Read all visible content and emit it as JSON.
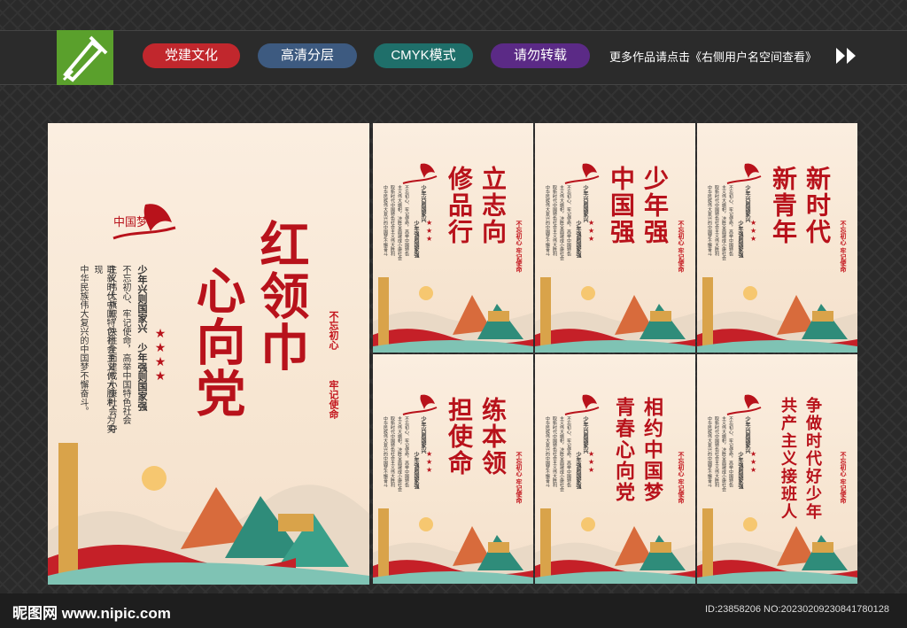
{
  "topbar": {
    "tags": [
      {
        "label": "党建文化",
        "color": "#c1272d"
      },
      {
        "label": "高清分层",
        "color": "#3d5a80"
      },
      {
        "label": "CMYK模式",
        "color": "#1f6f6a"
      },
      {
        "label": "请勿转载",
        "color": "#5b2a86"
      }
    ],
    "notice": "更多作品请点击《右侧用户名空间查看》"
  },
  "main_panel": {
    "title_line1": "红领巾",
    "title_line2": "心向党",
    "slogan_a": "不忘初心",
    "slogan_b": "牢记使命",
    "subtitle_a": "少年兴则国家兴",
    "subtitle_b": "少年强则国家强",
    "paragraph": [
      "不忘初心、牢记使命，高举中国特色社会",
      "主义伟大旗帜，决胜全面建成小康社会，夺",
      "取新时代中国特色社会主义伟大胜利，为实现",
      "中华民族伟大复兴的中国梦不懈奋斗。"
    ],
    "emblem_text": "中国梦"
  },
  "panels": [
    {
      "title": [
        "立志向",
        "修品行"
      ],
      "slogan": "不忘初心 牢记使命"
    },
    {
      "title": [
        "少年强",
        "中国强"
      ],
      "slogan": "不忘初心 牢记使命"
    },
    {
      "title": [
        "新时代",
        "新青年"
      ],
      "slogan": "不忘初心 牢记使命"
    },
    {
      "title": [
        "练本领",
        "担使命"
      ],
      "slogan": "不忘初心 牢记使命"
    },
    {
      "title": [
        "相约中国梦",
        "青春心向党"
      ],
      "slogan": "不忘初心 牢记使命"
    },
    {
      "title": [
        "争做时代好少年",
        "共产主义接班人"
      ],
      "slogan": "不忘初心 牢记使命"
    }
  ],
  "small_text": [
    "少年兴则国家兴",
    "少年强则国家强"
  ],
  "small_paragraph": [
    "不忘初心、牢记使命，高举中国特色",
    "主义伟大旗帜，决胜全面建成小康社会",
    "取新时代中国特色社会主义伟大胜利",
    "中华民族伟大复兴的中国梦不懈奋斗"
  ],
  "footer": {
    "watermark": "昵图网 www.nipic.com",
    "image_id": "ID:23858206 NO:20230209230841780128"
  },
  "colors": {
    "accent_red": "#b8121b",
    "logo_green": "#5aa02c"
  }
}
